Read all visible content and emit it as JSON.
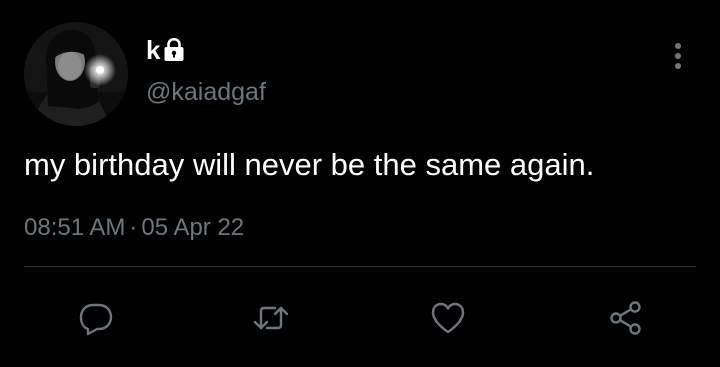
{
  "tweet": {
    "author": {
      "display_name": "k",
      "handle": "@kaiadgaf",
      "protected_icon": "lock-icon",
      "avatar": "profile-photo"
    },
    "text": "my birthday will never be the same again.",
    "time": "08:51 AM",
    "separator": "·",
    "date": "05 Apr 22"
  },
  "actions": [
    {
      "name": "reply",
      "icon": "reply-icon"
    },
    {
      "name": "retweet",
      "icon": "retweet-icon"
    },
    {
      "name": "like",
      "icon": "heart-icon"
    },
    {
      "name": "share",
      "icon": "share-icon"
    }
  ],
  "menu_icon": "more-options-icon",
  "colors": {
    "background": "#000000",
    "primary_text": "#ffffff",
    "secondary_text": "#6e767d",
    "divider": "#2f3336"
  }
}
